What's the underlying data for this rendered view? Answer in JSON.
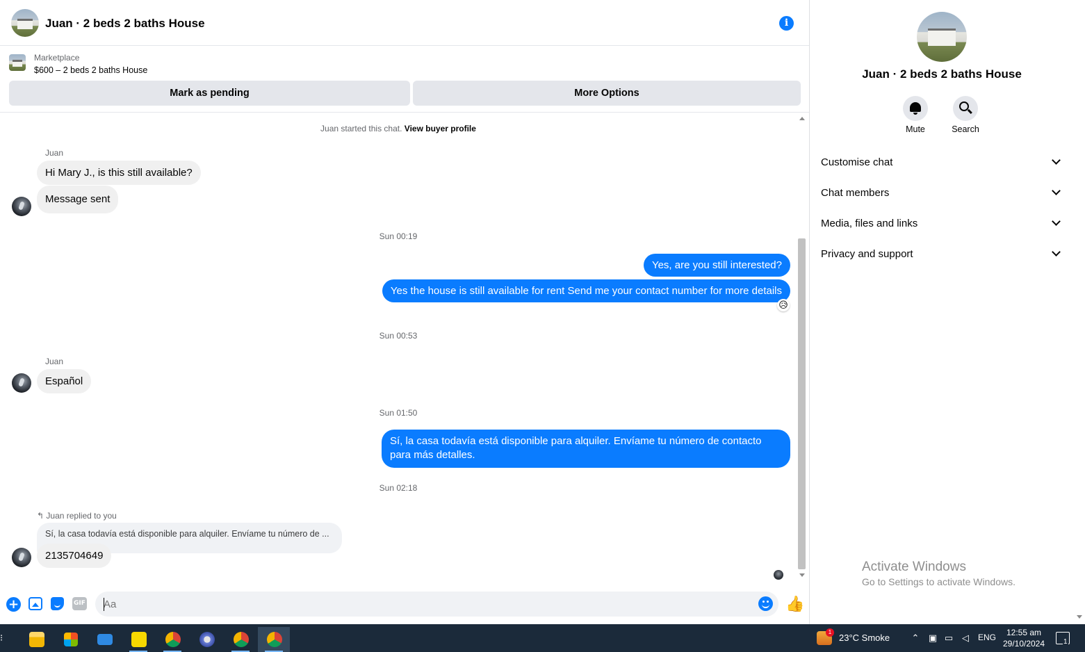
{
  "header": {
    "title": "Juan · 2 beds 2 baths House",
    "info_icon": "info-icon"
  },
  "listing": {
    "source": "Marketplace",
    "title": "$600 – 2 beds 2 baths House",
    "mark_pending_label": "Mark as pending",
    "more_options_label": "More Options"
  },
  "thread": {
    "started_text": "Juan started this chat.",
    "view_profile_link": "View buyer profile",
    "messages": [
      {
        "sender": "Juan",
        "text": "Hi Mary J., is this still available?"
      },
      {
        "text": "Message sent"
      },
      {
        "timestamp": "Sun 00:19"
      },
      {
        "text": "Yes, are you still interested?"
      },
      {
        "text": "Yes the house is still available for rent Send me your contact number for more details",
        "reaction": "😥"
      },
      {
        "timestamp": "Sun 00:53"
      },
      {
        "sender": "Juan",
        "text": "Español"
      },
      {
        "timestamp": "Sun 01:50"
      },
      {
        "text": "Sí, la casa todavía está disponible para alquiler. Envíame tu número de contacto para más detalles."
      },
      {
        "timestamp": "Sun 02:18"
      },
      {
        "reply_label": "Juan replied to you",
        "quoted": "Sí, la casa todavía está disponible para alquiler. Envíame tu número de ...",
        "text": "2135704649"
      }
    ]
  },
  "composer": {
    "placeholder": "Aa",
    "gif_label": "GIF",
    "like_icon": "thumbs-up-icon"
  },
  "details": {
    "title": "Juan · 2 beds 2 baths House",
    "mute_label": "Mute",
    "search_label": "Search",
    "sections": [
      "Customise chat",
      "Chat members",
      "Media, files and links",
      "Privacy and support"
    ]
  },
  "watermark": {
    "title": "Activate Windows",
    "subtitle": "Go to Settings to activate Windows."
  },
  "taskbar": {
    "weather": "23°C  Smoke",
    "weather_badge": "1",
    "language": "ENG",
    "time": "12:55 am",
    "date": "29/10/2024",
    "notification_count": "1"
  },
  "colors": {
    "accent": "#0a7cff",
    "bubble_in": "#f0f0f0",
    "taskbar": "#1b2a3a"
  }
}
